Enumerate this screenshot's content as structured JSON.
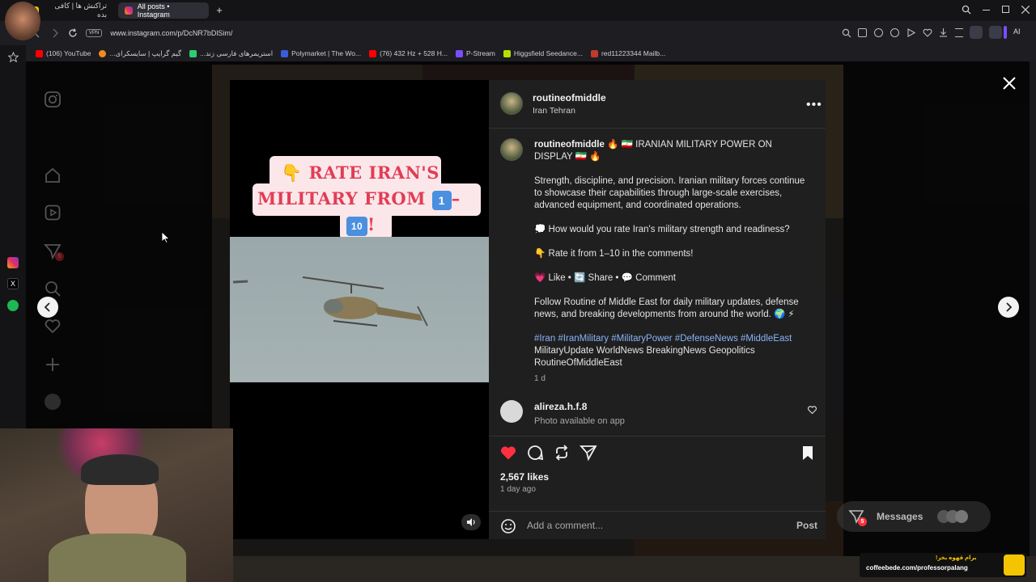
{
  "browser": {
    "tabs": [
      {
        "title": "تراکنش ها | کافی بده",
        "active": false
      },
      {
        "title": "All posts • Instagram",
        "active": true
      }
    ],
    "new_tab_label": "+",
    "vpn_label": "VPN",
    "url": "www.instagram.com/p/DcNR7bDlSim/",
    "ai_label": "AI",
    "bookmarks": [
      {
        "label": "(106) YouTube",
        "color": "#ff0000"
      },
      {
        "label": "گیم گرایپ | سایسکرای...",
        "color": "#f08a24"
      },
      {
        "label": "استریمرهای فارسی زند...",
        "color": "#2ecc71"
      },
      {
        "label": "Polymarket | The Wo...",
        "color": "#3b5bdb"
      },
      {
        "label": "(76) 432 Hz + 528 H...",
        "color": "#ff0000"
      },
      {
        "label": "P-Stream",
        "color": "#7b4dff"
      },
      {
        "label": "Higgsfield Seedance...",
        "color": "#b6e000"
      },
      {
        "label": "red11223344 Mailb...",
        "color": "#c0392b"
      }
    ]
  },
  "post": {
    "author": "routineofmiddle",
    "location": "Iran Tehran",
    "caption_title": "🔥 🇮🇷 IRANIAN MILITARY POWER ON DISPLAY 🇮🇷 🔥",
    "paragraphs": [
      "Strength, discipline, and precision. Iranian military forces continue to showcase their capabilities through large-scale exercises, advanced equipment, and coordinated operations.",
      "💭 How would you rate Iran's military strength and readiness?",
      "👇 Rate it from 1–10 in the comments!",
      "💗 Like • 🔄 Share • 💬 Comment",
      "Follow Routine of Middle East for daily military updates, defense news, and breaking developments from around the world. 🌍 ⚡"
    ],
    "hashtags": "#Iran #IranMilitary #MilitaryPower #DefenseNews #MiddleEast",
    "plain_tags": "MilitaryUpdate WorldNews BreakingNews Geopolitics RoutineOfMiddleEast",
    "caption_age": "1 d",
    "comment": {
      "user": "alireza.h.f.8",
      "text": "Photo available on app"
    },
    "likes": "2,567 likes",
    "posted": "1 day ago",
    "add_comment_placeholder": "Add a comment...",
    "post_button": "Post",
    "liked": true
  },
  "media": {
    "overlay_line1": "👇 RATE IRAN'S",
    "overlay_line2": "MILITARY FROM",
    "emoji_one": "1",
    "emoji_ten": "10",
    "exclaim": "!",
    "dash": "–"
  },
  "messages_label": "Messages",
  "messages_badge": "5",
  "nav_badge": "5",
  "coffee": {
    "line1": "برام قهوه بخر!",
    "line2": "coffeebede.com/professorpalang"
  },
  "colors": {
    "accent_like": "#ff3040",
    "hashtag": "#8ab4f8",
    "overlay_text": "#e23d56"
  }
}
